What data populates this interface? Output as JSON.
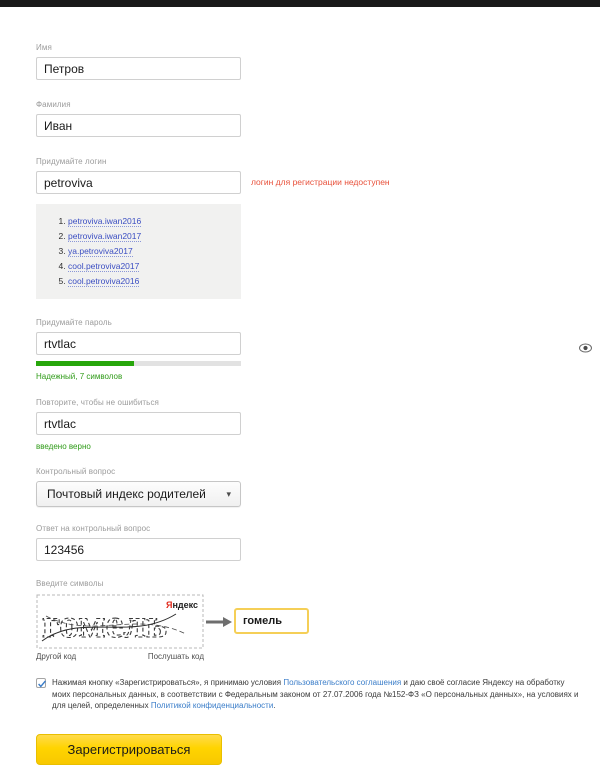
{
  "form": {
    "first_name": {
      "label": "Имя",
      "value": "Петров"
    },
    "last_name": {
      "label": "Фамилия",
      "value": "Иван"
    },
    "login": {
      "label": "Придумайте логин",
      "value": "petroviva",
      "error": "логин для регистрации недоступен",
      "suggestions": [
        "petroviva.iwan2016",
        "petroviva.iwan2017",
        "ya.petroviva2017",
        "cool.petroviva2017",
        "cool.petroviva2016"
      ]
    },
    "password": {
      "label": "Придумайте пароль",
      "value": "rtvtlac",
      "strength_text": "Надежный, 7 символов",
      "strength_percent": 48,
      "strength_color": "#27a60b"
    },
    "password_repeat": {
      "label": "Повторите, чтобы не ошибиться",
      "value": "rtvtlac",
      "status": "введено верно"
    },
    "security_question": {
      "label": "Контрольный вопрос",
      "selected": "Почтовый индекс родителей"
    },
    "security_answer": {
      "label": "Ответ на контрольный вопрос",
      "value": "123456"
    },
    "captcha": {
      "label": "Введите символы",
      "image_text": "гомель",
      "logo_ya": "Я",
      "logo_rest": "ндекс",
      "refresh_link": "Другой код",
      "audio_link": "Послушать код",
      "value": "гомель"
    },
    "consent": {
      "checked": true,
      "part1": "Нажимая кнопку «Зарегистрироваться», я принимаю условия ",
      "link1": "Пользовательского соглашения",
      "part2": " и даю своё согласие Яндексу на обработку моих персональных данных, в соответствии с Федеральным законом от 27.07.2006 года №152-ФЗ «О персональных данных», на условиях и для целей, определенных ",
      "link2": "Политикой конфиденциальности",
      "part3": "."
    },
    "submit_label": "Зарегистрироваться"
  },
  "colors": {
    "accent_yellow": "#ffd400",
    "error_red": "#e8503a",
    "success_green": "#2f9b18",
    "link_blue": "#3a7dc9",
    "suggest_blue": "#3b4ec2"
  }
}
